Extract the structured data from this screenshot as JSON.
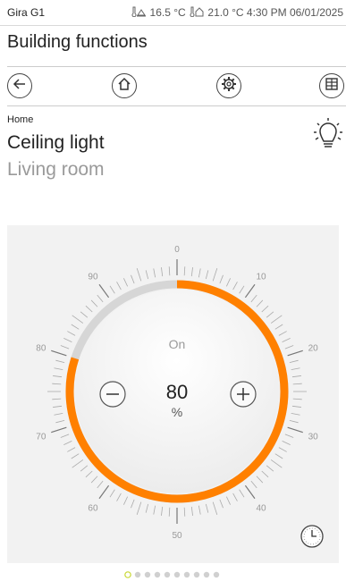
{
  "status": {
    "app_name": "Gira G1",
    "indoor_temp": "16.5 °C",
    "outdoor_temp": "21.0 °C",
    "time": "4:30 PM",
    "date": "06/01/2025"
  },
  "page_title": "Building functions",
  "nav": [
    {
      "name": "back",
      "icon": "arrow-left-icon"
    },
    {
      "name": "home",
      "icon": "house-icon"
    },
    {
      "name": "settings",
      "icon": "gear-icon"
    },
    {
      "name": "grid",
      "icon": "grid-icon"
    }
  ],
  "device": {
    "breadcrumb": "Home",
    "title": "Ceiling light",
    "room": "Living room",
    "icon": "light-bulb-icon"
  },
  "dimmer": {
    "state_label": "On",
    "value": "80",
    "unit": "%",
    "level_percent": 80,
    "scale_labels": [
      "0",
      "10",
      "20",
      "30",
      "40",
      "50",
      "60",
      "70",
      "80",
      "90"
    ],
    "decrease_icon": "minus-icon",
    "increase_icon": "plus-icon",
    "timer_icon": "clock-icon"
  },
  "pagination": {
    "count": 10,
    "active": 0
  },
  "colors": {
    "accent": "#ff8000",
    "track": "#d6d6d6",
    "panel": "#f2f2f2",
    "active_dot": "#c8d832"
  }
}
